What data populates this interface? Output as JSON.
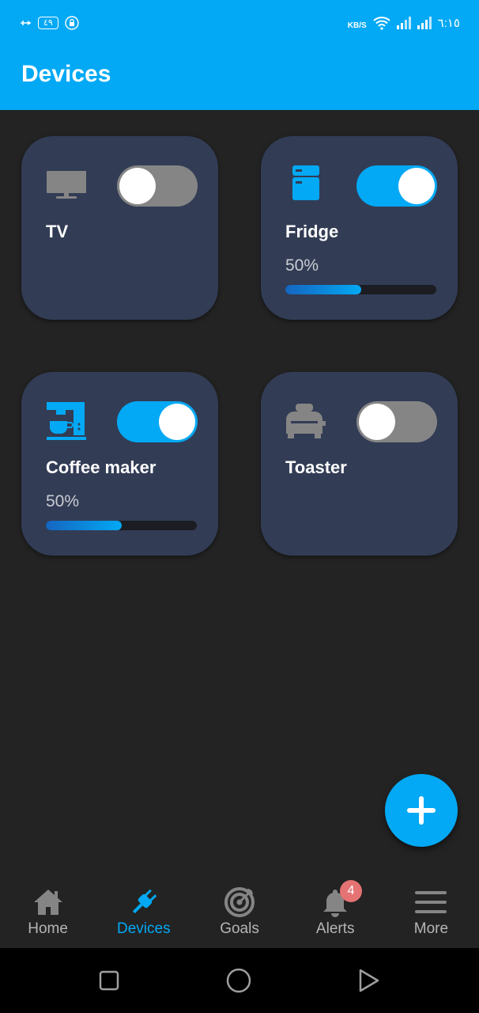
{
  "status_bar": {
    "left_badge": "٤٩",
    "speed_unit": "KB/S",
    "time": "٦:١٥"
  },
  "header": {
    "title": "Devices"
  },
  "colors": {
    "accent": "#03a9f4",
    "card": "#323c55",
    "background": "#232323",
    "toggle_off": "#858585",
    "badge": "#e57373"
  },
  "devices": [
    {
      "name": "TV",
      "icon": "tv-icon",
      "on": false,
      "power_percent": null
    },
    {
      "name": "Fridge",
      "icon": "fridge-icon",
      "on": true,
      "power_label": "50%",
      "power_fraction": 0.5
    },
    {
      "name": "Coffee maker",
      "icon": "coffee-maker-icon",
      "on": true,
      "power_label": "50%",
      "power_fraction": 0.5
    },
    {
      "name": "Toaster",
      "icon": "toaster-icon",
      "on": false,
      "power_percent": null
    }
  ],
  "fab": {
    "icon": "plus-icon"
  },
  "bottom_nav": {
    "items": [
      {
        "label": "Home",
        "icon": "home-icon",
        "active": false
      },
      {
        "label": "Devices",
        "icon": "plug-icon",
        "active": true
      },
      {
        "label": "Goals",
        "icon": "target-icon",
        "active": false
      },
      {
        "label": "Alerts",
        "icon": "bell-icon",
        "active": false,
        "badge": "4"
      },
      {
        "label": "More",
        "icon": "menu-icon",
        "active": false
      }
    ]
  },
  "system_nav": {
    "buttons": [
      "recents-icon",
      "home-circle-icon",
      "back-triangle-icon"
    ]
  }
}
